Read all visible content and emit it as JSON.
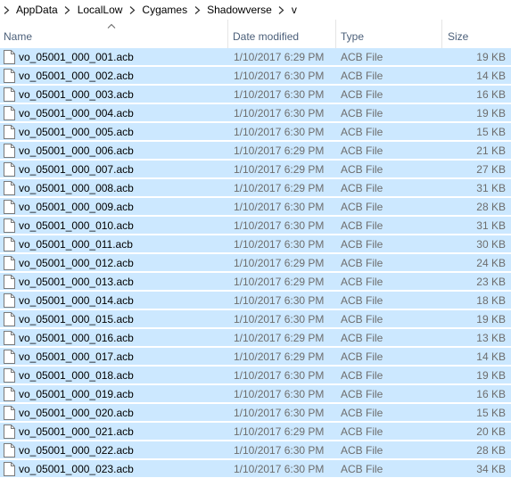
{
  "breadcrumb": {
    "items": [
      "AppData",
      "LocalLow",
      "Cygames",
      "Shadowverse",
      "v"
    ]
  },
  "columns": {
    "name": "Name",
    "date": "Date modified",
    "type": "Type",
    "size": "Size",
    "sorted_by": "name"
  },
  "colors": {
    "row_selected": "#cce8ff",
    "header_text": "#4c607a",
    "meta_text": "#6d6d6d"
  },
  "files": [
    {
      "name": "vo_05001_000_001.acb",
      "date": "1/10/2017 6:29 PM",
      "type": "ACB File",
      "size": "19 KB"
    },
    {
      "name": "vo_05001_000_002.acb",
      "date": "1/10/2017 6:30 PM",
      "type": "ACB File",
      "size": "14 KB"
    },
    {
      "name": "vo_05001_000_003.acb",
      "date": "1/10/2017 6:30 PM",
      "type": "ACB File",
      "size": "16 KB"
    },
    {
      "name": "vo_05001_000_004.acb",
      "date": "1/10/2017 6:30 PM",
      "type": "ACB File",
      "size": "19 KB"
    },
    {
      "name": "vo_05001_000_005.acb",
      "date": "1/10/2017 6:30 PM",
      "type": "ACB File",
      "size": "15 KB"
    },
    {
      "name": "vo_05001_000_006.acb",
      "date": "1/10/2017 6:29 PM",
      "type": "ACB File",
      "size": "21 KB"
    },
    {
      "name": "vo_05001_000_007.acb",
      "date": "1/10/2017 6:29 PM",
      "type": "ACB File",
      "size": "27 KB"
    },
    {
      "name": "vo_05001_000_008.acb",
      "date": "1/10/2017 6:29 PM",
      "type": "ACB File",
      "size": "31 KB"
    },
    {
      "name": "vo_05001_000_009.acb",
      "date": "1/10/2017 6:30 PM",
      "type": "ACB File",
      "size": "28 KB"
    },
    {
      "name": "vo_05001_000_010.acb",
      "date": "1/10/2017 6:30 PM",
      "type": "ACB File",
      "size": "31 KB"
    },
    {
      "name": "vo_05001_000_011.acb",
      "date": "1/10/2017 6:30 PM",
      "type": "ACB File",
      "size": "30 KB"
    },
    {
      "name": "vo_05001_000_012.acb",
      "date": "1/10/2017 6:29 PM",
      "type": "ACB File",
      "size": "24 KB"
    },
    {
      "name": "vo_05001_000_013.acb",
      "date": "1/10/2017 6:29 PM",
      "type": "ACB File",
      "size": "23 KB"
    },
    {
      "name": "vo_05001_000_014.acb",
      "date": "1/10/2017 6:30 PM",
      "type": "ACB File",
      "size": "18 KB"
    },
    {
      "name": "vo_05001_000_015.acb",
      "date": "1/10/2017 6:30 PM",
      "type": "ACB File",
      "size": "19 KB"
    },
    {
      "name": "vo_05001_000_016.acb",
      "date": "1/10/2017 6:29 PM",
      "type": "ACB File",
      "size": "13 KB"
    },
    {
      "name": "vo_05001_000_017.acb",
      "date": "1/10/2017 6:29 PM",
      "type": "ACB File",
      "size": "14 KB"
    },
    {
      "name": "vo_05001_000_018.acb",
      "date": "1/10/2017 6:30 PM",
      "type": "ACB File",
      "size": "19 KB"
    },
    {
      "name": "vo_05001_000_019.acb",
      "date": "1/10/2017 6:30 PM",
      "type": "ACB File",
      "size": "16 KB"
    },
    {
      "name": "vo_05001_000_020.acb",
      "date": "1/10/2017 6:30 PM",
      "type": "ACB File",
      "size": "15 KB"
    },
    {
      "name": "vo_05001_000_021.acb",
      "date": "1/10/2017 6:29 PM",
      "type": "ACB File",
      "size": "20 KB"
    },
    {
      "name": "vo_05001_000_022.acb",
      "date": "1/10/2017 6:30 PM",
      "type": "ACB File",
      "size": "28 KB"
    },
    {
      "name": "vo_05001_000_023.acb",
      "date": "1/10/2017 6:30 PM",
      "type": "ACB File",
      "size": "34 KB"
    }
  ]
}
